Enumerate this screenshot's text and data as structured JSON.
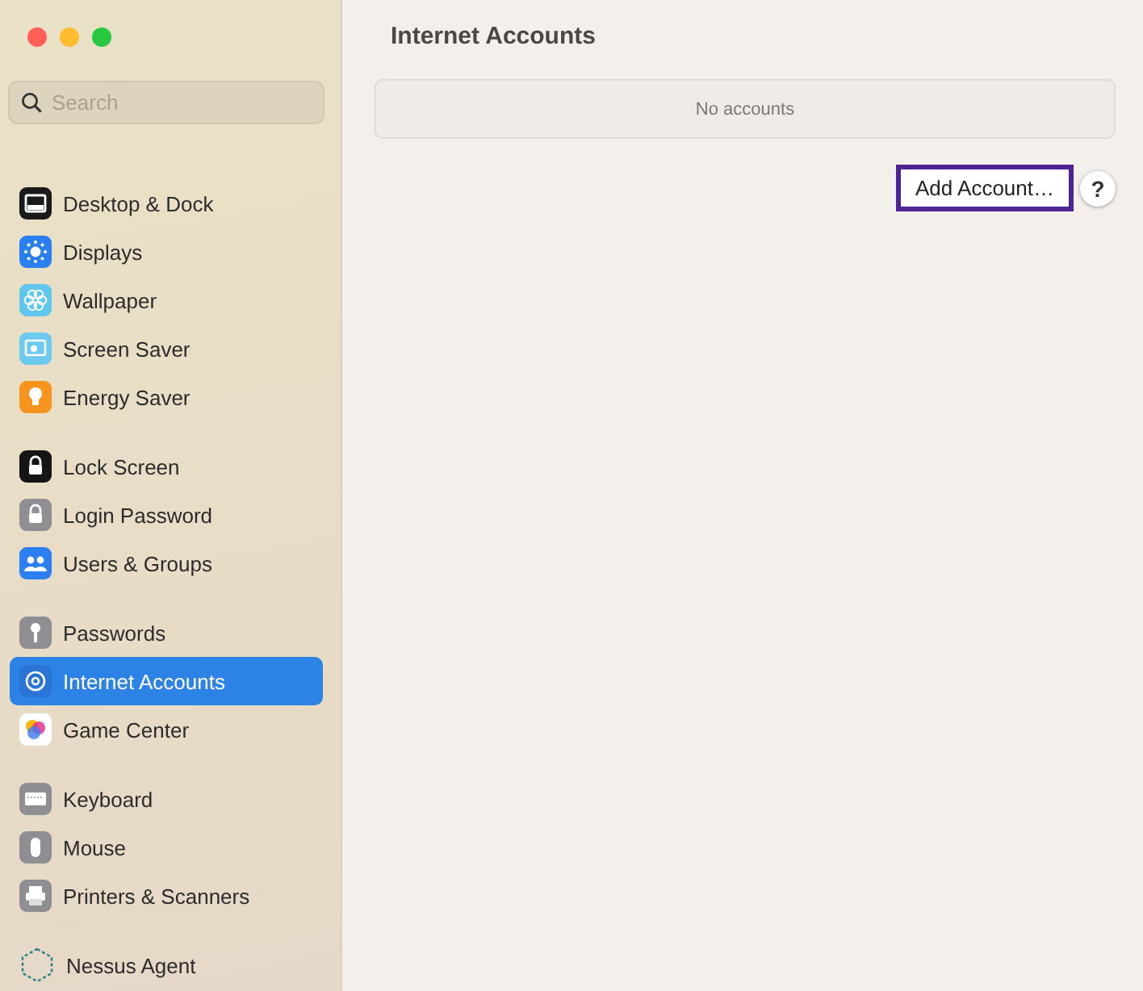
{
  "window": {
    "title": "Internet Accounts"
  },
  "search": {
    "placeholder": "Search"
  },
  "sidebar": {
    "groups": [
      [
        {
          "label": "Desktop & Dock",
          "kind": "desktop",
          "selected": false
        },
        {
          "label": "Displays",
          "kind": "displays",
          "selected": false
        },
        {
          "label": "Wallpaper",
          "kind": "wallpaper",
          "selected": false
        },
        {
          "label": "Screen Saver",
          "kind": "screensaver",
          "selected": false
        },
        {
          "label": "Energy Saver",
          "kind": "energy",
          "selected": false
        }
      ],
      [
        {
          "label": "Lock Screen",
          "kind": "lock",
          "selected": false
        },
        {
          "label": "Login Password",
          "kind": "password",
          "selected": false
        },
        {
          "label": "Users & Groups",
          "kind": "users",
          "selected": false
        }
      ],
      [
        {
          "label": "Passwords",
          "kind": "key",
          "selected": false
        },
        {
          "label": "Internet Accounts",
          "kind": "at",
          "selected": true
        },
        {
          "label": "Game Center",
          "kind": "game",
          "selected": false
        }
      ],
      [
        {
          "label": "Keyboard",
          "kind": "keyboard",
          "selected": false
        },
        {
          "label": "Mouse",
          "kind": "mouse",
          "selected": false
        },
        {
          "label": "Printers & Scanners",
          "kind": "printer",
          "selected": false
        }
      ],
      [
        {
          "label": "Nessus Agent",
          "kind": "nessus",
          "selected": false
        }
      ]
    ]
  },
  "accounts": {
    "empty_text": "No accounts"
  },
  "buttons": {
    "add": "Add Account…",
    "help": "?"
  }
}
